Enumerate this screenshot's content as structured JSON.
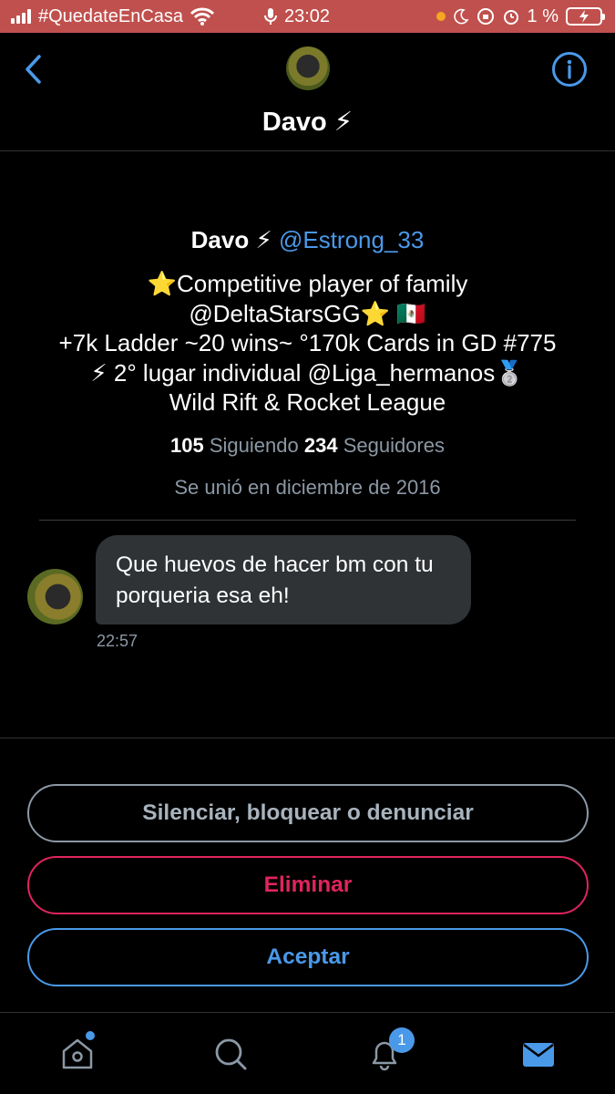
{
  "status_bar": {
    "carrier": "#QuedateEnCasa",
    "time": "23:02",
    "battery": "1 %"
  },
  "header": {
    "title": "Davo ⚡"
  },
  "profile": {
    "name": "Davo ⚡",
    "handle": "@Estrong_33",
    "bio_lines": [
      "⭐Competitive player of family",
      "@DeltaStarsGG⭐ 🇲🇽",
      "+7k Ladder ~20 wins~  °170k Cards in GD #775",
      "⚡ 2° lugar individual @Liga_hermanos🥈",
      "Wild Rift & Rocket League"
    ],
    "following_count": "105",
    "following_label": "Siguiendo",
    "followers_count": "234",
    "followers_label": "Seguidores",
    "joined": "Se unió en diciembre de 2016"
  },
  "message": {
    "text": "Que huevos de hacer bm con tu porqueria esa eh!",
    "time": "22:57"
  },
  "actions": {
    "mute": "Silenciar, bloquear o denunciar",
    "delete": "Eliminar",
    "accept": "Aceptar"
  },
  "tabbar": {
    "notifications_badge": "1"
  },
  "colors": {
    "accent": "#4a99e9",
    "danger": "#e0245e",
    "status_bar": "#c0504d"
  }
}
